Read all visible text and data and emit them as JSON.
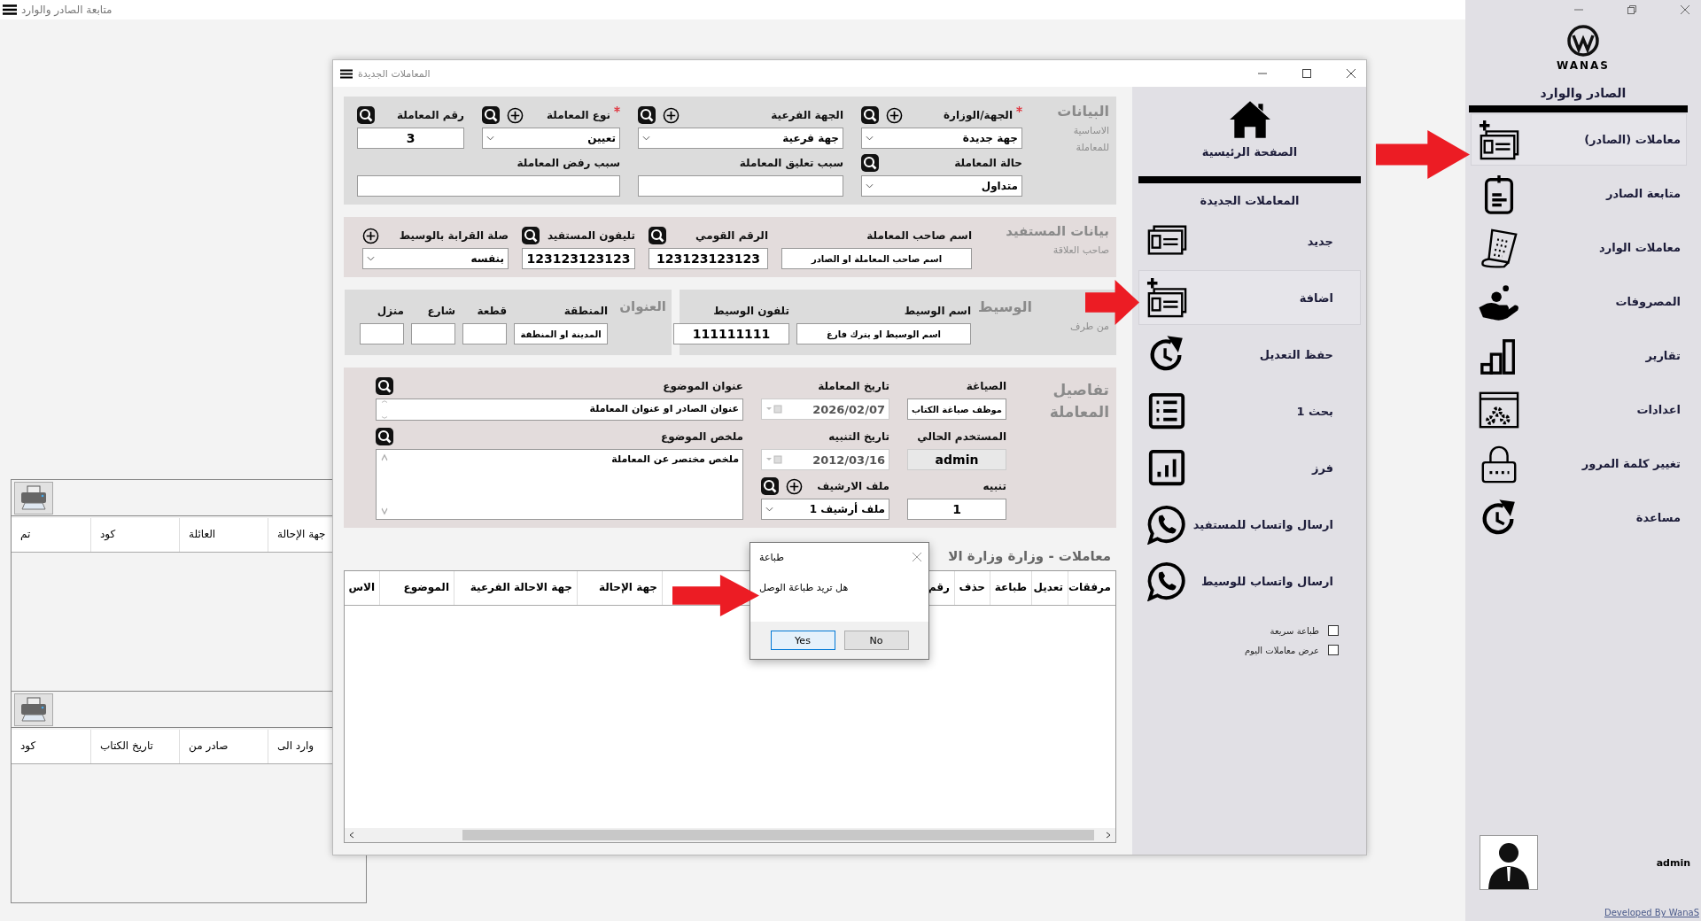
{
  "app": {
    "title": "متابعة الصادر والوارد"
  },
  "sidebar": {
    "brand": "WANAS",
    "title": "الصادر والوارد",
    "items": [
      {
        "label": "معاملات (الصادر)",
        "selected": true
      },
      {
        "label": "متابعة الصادر",
        "selected": false
      },
      {
        "label": "معاملات الوارد",
        "selected": false
      },
      {
        "label": "المصروفات",
        "selected": false
      },
      {
        "label": "تقارير",
        "selected": false
      },
      {
        "label": "اعدادات",
        "selected": false
      },
      {
        "label": "تغيير كلمة المرور",
        "selected": false
      },
      {
        "label": "مساعدة",
        "selected": false
      }
    ],
    "user": "admin",
    "footer": "Developed By WanaS"
  },
  "background_panels": [
    {
      "columns": [
        "جهة الإحالة",
        "العائلة",
        "كود",
        "تم"
      ]
    },
    {
      "columns": [
        "وارد الى",
        "صادر من",
        "تاريخ الكتاب",
        "كود"
      ]
    }
  ],
  "window": {
    "title": "المعاملات الجديدة",
    "sections": [
      {
        "kind": "basic",
        "title": "البيانات",
        "subtitle": "الاساسية للمعاملة",
        "fields": [
          {
            "label": "الجهة/الوزارة",
            "required": true,
            "kind": "select",
            "value": "جهة جديدة",
            "add": true,
            "search": true
          },
          {
            "label": "الجهة الفرعية",
            "required": false,
            "kind": "select",
            "value": "جهة فرعية",
            "add": true,
            "search": true
          },
          {
            "label": "نوع المعاملة",
            "required": true,
            "kind": "select",
            "value": "تعيين",
            "add": true,
            "search": true
          },
          {
            "label": "رقم المعاملة",
            "required": false,
            "kind": "number",
            "value": "3",
            "add": false,
            "search": true
          },
          {
            "label": "حالة المعاملة",
            "required": false,
            "kind": "select",
            "value": "متداول",
            "add": false,
            "search": true
          },
          {
            "label": "سبب تعليق المعاملة",
            "required": false,
            "kind": "text",
            "add": false,
            "search": false
          },
          {
            "label": "سبب رفض المعاملة",
            "required": false,
            "kind": "text",
            "add": false,
            "search": false
          }
        ]
      },
      {
        "kind": "beneficiary",
        "title": "بيانات المستفيد",
        "subtitle": "صاحب العلاقة",
        "fields": [
          {
            "label": "اسم صاحب المعاملة",
            "kind": "text",
            "value": "اسم صاحب المعاملة او الصادر",
            "add": false,
            "search": false
          },
          {
            "label": "الرقم القومي",
            "kind": "number",
            "value": "123123123123",
            "add": false,
            "search": true
          },
          {
            "label": "تليفون المستفيد",
            "kind": "number",
            "value": "123123123123",
            "add": false,
            "search": true
          },
          {
            "label": "صلة القرابة بالوسيط",
            "kind": "select",
            "value": "بنفسه",
            "add": true,
            "search": false
          }
        ]
      },
      {
        "kind": "intermediary",
        "title": "الوسيط",
        "subtitle": "من طرف",
        "fields": [
          {
            "label": "اسم الوسيط",
            "kind": "text",
            "value": "اسم الوسيط او يترك فارغ",
            "add": false,
            "search": false
          },
          {
            "label": "تلفون الوسيط",
            "kind": "number",
            "value": "111111111",
            "add": false,
            "search": false
          }
        ]
      },
      {
        "kind": "address",
        "title": "العنوان",
        "fields": [
          {
            "label": "المنطقة",
            "kind": "text",
            "value": "المدينة او المنطقة",
            "add": false,
            "search": false
          },
          {
            "label": "قطعة",
            "kind": "text",
            "add": false,
            "search": false
          },
          {
            "label": "شارع",
            "kind": "text",
            "add": false,
            "search": false
          },
          {
            "label": "منزل",
            "kind": "text",
            "add": false,
            "search": false
          }
        ]
      },
      {
        "kind": "details",
        "title": "تفاصيل المعاملة",
        "fields": [
          {
            "label": "الصياغة",
            "kind": "text",
            "value": "موظف صياغة الكتاب",
            "add": false,
            "search": false
          },
          {
            "label": "تاريخ المعاملة",
            "kind": "date",
            "value": "2026/02/07",
            "add": false,
            "search": false
          },
          {
            "label": "عنوان الموضوع",
            "kind": "textarea",
            "value": "عنوان الصادر او عنوان المعاملة",
            "add": false,
            "search": true
          },
          {
            "label": "المستخدم الحالي",
            "kind": "readonly",
            "value": "admin",
            "add": false,
            "search": false
          },
          {
            "label": "تاريخ التنبيه",
            "kind": "date",
            "value": "2012/03/16",
            "add": false,
            "search": false
          },
          {
            "label": "ملخص الموضوع",
            "kind": "memo",
            "value": "ملخص مختصر عن المعاملة",
            "add": false,
            "search": true
          },
          {
            "label": "تنبيه",
            "kind": "number",
            "value": "1",
            "add": false,
            "search": false
          },
          {
            "label": "ملف الارشيف",
            "kind": "select",
            "value": "ملف أرشيف 1",
            "add": true,
            "search": true
          }
        ]
      }
    ],
    "grid": {
      "title": "معاملات - وزارة وزارة الا",
      "columns": [
        "مرفقات",
        "تعديل",
        "طباعة",
        "حذف",
        "رقم",
        "جهة الإحالة",
        "جهة الاحالة الفرعية",
        "الموضوع",
        "الاس"
      ]
    },
    "pane": {
      "home": "الصفحة الرئيسية",
      "title": "المعاملات الجديدة",
      "items": [
        {
          "label": "جديد",
          "selected": false
        },
        {
          "label": "اضافة",
          "selected": true
        },
        {
          "label": "حفظ التعديل",
          "selected": false
        },
        {
          "label": "بحث 1",
          "selected": false
        },
        {
          "label": "فرز",
          "selected": false
        },
        {
          "label": "ارسال واتساب للمستفيد",
          "selected": false
        },
        {
          "label": "ارسال واتساب للوسيط",
          "selected": false
        }
      ],
      "options": [
        {
          "label": "طباعة سريعة",
          "checked": false
        },
        {
          "label": "عرض معاملات اليوم",
          "checked": false
        }
      ]
    }
  },
  "dialog": {
    "title": "طباعة",
    "message": "هل تريد طباعة الوصل",
    "buttons": [
      {
        "label": "No",
        "selected": false
      },
      {
        "label": "Yes",
        "selected": true
      }
    ]
  }
}
